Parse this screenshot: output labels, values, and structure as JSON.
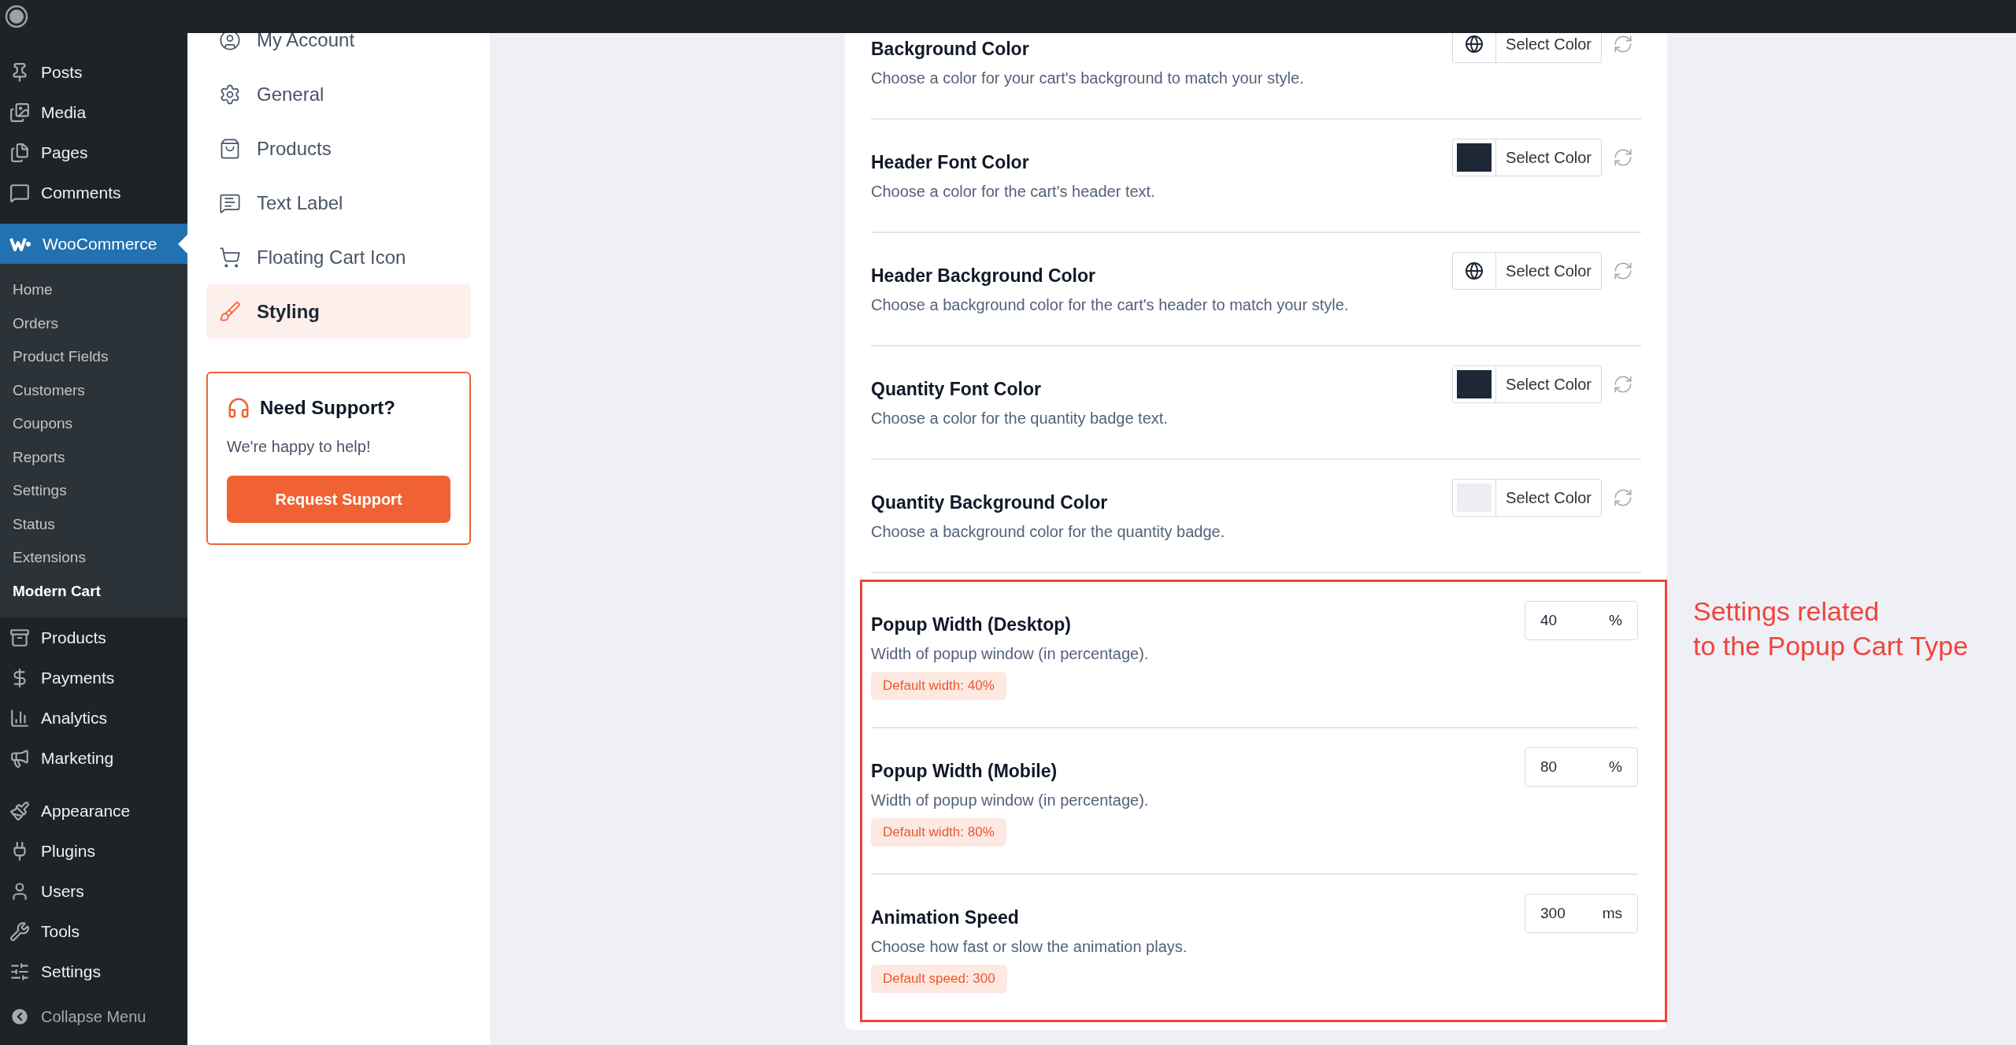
{
  "sidebar": {
    "groups": [
      {
        "items": [
          {
            "label": "Posts",
            "selected": false
          },
          {
            "label": "Media",
            "selected": false
          },
          {
            "label": "Pages",
            "selected": false
          },
          {
            "label": "Comments",
            "selected": false
          }
        ]
      },
      {
        "items": [
          {
            "label": "WooCommerce",
            "selected": true,
            "children": [
              {
                "label": "Home",
                "selected": false
              },
              {
                "label": "Orders",
                "selected": false
              },
              {
                "label": "Product Fields",
                "selected": false
              },
              {
                "label": "Customers",
                "selected": false
              },
              {
                "label": "Coupons",
                "selected": false
              },
              {
                "label": "Reports",
                "selected": false
              },
              {
                "label": "Settings",
                "selected": false
              },
              {
                "label": "Status",
                "selected": false
              },
              {
                "label": "Extensions",
                "selected": false
              },
              {
                "label": "Modern Cart",
                "selected": true
              }
            ]
          },
          {
            "label": "Products",
            "selected": false
          },
          {
            "label": "Payments",
            "selected": false
          },
          {
            "label": "Analytics",
            "selected": false
          },
          {
            "label": "Marketing",
            "selected": false
          }
        ]
      },
      {
        "items": [
          {
            "label": "Appearance",
            "selected": false
          },
          {
            "label": "Plugins",
            "selected": false
          },
          {
            "label": "Users",
            "selected": false
          },
          {
            "label": "Tools",
            "selected": false
          },
          {
            "label": "Settings",
            "selected": false
          }
        ]
      }
    ],
    "collapse": "Collapse Menu"
  },
  "settings_nav": {
    "items": [
      {
        "label": "My Account",
        "selected": false
      },
      {
        "label": "General",
        "selected": false
      },
      {
        "label": "Products",
        "selected": false
      },
      {
        "label": "Text Label",
        "selected": false
      },
      {
        "label": "Floating Cart Icon",
        "selected": false
      },
      {
        "label": "Styling",
        "selected": true
      }
    ],
    "support": {
      "title": "Need Support?",
      "text": "We're happy to help!",
      "button": "Request Support"
    }
  },
  "color_settings": [
    {
      "title": "Background Color",
      "description": "Choose a color for your cart's background to match your style.",
      "button": "Select Color"
    },
    {
      "title": "Header Font Color",
      "description": "Choose a color for the cart's header text.",
      "button": "Select Color",
      "color": "#1e2735"
    },
    {
      "title": "Header Background Color",
      "description": "Choose a background color for the cart's header to match your style.",
      "button": "Select Color"
    },
    {
      "title": "Quantity Font Color",
      "description": "Choose a color for the quantity badge text.",
      "button": "Select Color",
      "color": "#1e2735"
    },
    {
      "title": "Quantity Background Color",
      "description": "Choose a background color for the quantity badge.",
      "button": "Select Color",
      "color": "#eceef3"
    }
  ],
  "number_settings": [
    {
      "title": "Popup Width (Desktop)",
      "description": "Width of popup window (in percentage).",
      "default": "Default width: 40%",
      "value": "40",
      "unit": "%"
    },
    {
      "title": "Popup Width (Mobile)",
      "description": "Width of popup window (in percentage).",
      "default": "Default width: 80%",
      "value": "80",
      "unit": "%"
    },
    {
      "title": "Animation Speed",
      "description": "Choose how fast or slow the animation plays.",
      "default": "Default speed: 300",
      "value": "300",
      "unit": "ms"
    }
  ],
  "annotation": "Settings related\nto the Popup Cart Type"
}
